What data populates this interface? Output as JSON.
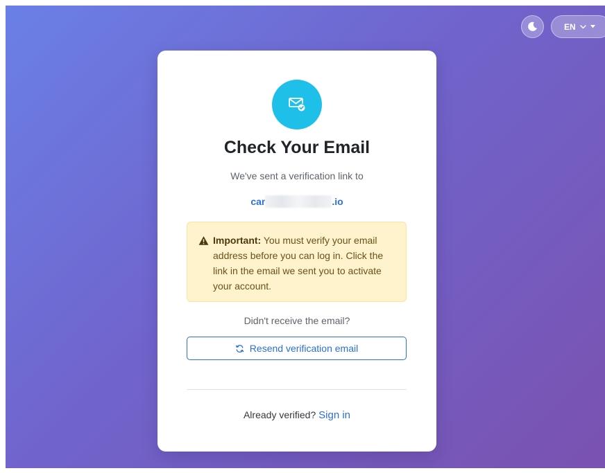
{
  "header": {
    "theme_toggle_icon": "moon-icon",
    "language": {
      "selected": "EN",
      "chevron_icon": "chevron-down-icon",
      "caret_icon": "caret-down-icon"
    }
  },
  "card": {
    "icon": "mail-check-icon",
    "title": "Check Your Email",
    "subtitle": "We've sent a verification link to",
    "email_prefix": "car",
    "email_suffix": ".io",
    "alert": {
      "icon": "warning-icon",
      "strong": "Important:",
      "text": " You must verify your email address before you can log in. Click the link in the email we sent you to activate your account."
    },
    "no_receive_text": "Didn't receive the email?",
    "resend_button": {
      "icon": "refresh-icon",
      "label": "Resend verification email"
    },
    "already_verified_text": "Already verified?",
    "sign_in_link": "Sign in"
  },
  "colors": {
    "background_gradient_start": "#6a80e6",
    "background_gradient_end": "#7a52b0",
    "icon_circle": "#1ec0ea",
    "primary_link": "#2b6fd6",
    "alert_background": "#fef3cd",
    "alert_text": "#6b5118"
  }
}
